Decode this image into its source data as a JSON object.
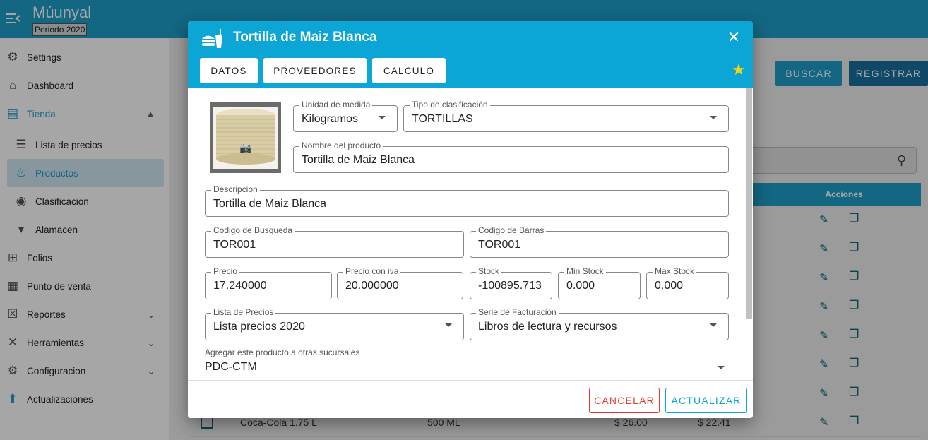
{
  "app": {
    "title": "Múunyal",
    "period": "Periodo 2020"
  },
  "sidebar": {
    "items": [
      {
        "label": "Settings",
        "icon": "gear-icon",
        "glyph": "⚙"
      },
      {
        "label": "Dashboard",
        "icon": "home-icon",
        "glyph": "⌂"
      },
      {
        "label": "Tienda",
        "icon": "store-icon",
        "glyph": "▤"
      },
      {
        "label": "Lista de precios",
        "icon": "clipboard-icon",
        "glyph": "☰"
      },
      {
        "label": "Productos",
        "icon": "food-icon",
        "glyph": "♨"
      },
      {
        "label": "Clasificacion",
        "icon": "broadcast-icon",
        "glyph": "◉"
      },
      {
        "label": "Alamacen",
        "icon": "caret-down-icon",
        "glyph": "▾"
      },
      {
        "label": "Folios",
        "icon": "folio-icon",
        "glyph": "⊞"
      },
      {
        "label": "Punto de venta",
        "icon": "cash-register-icon",
        "glyph": "▦"
      },
      {
        "label": "Reportes",
        "icon": "excel-icon",
        "glyph": "☒"
      },
      {
        "label": "Herramientas",
        "icon": "tools-icon",
        "glyph": "✕"
      },
      {
        "label": "Configuracion",
        "icon": "cog-icon",
        "glyph": "⚙"
      },
      {
        "label": "Actualizaciones",
        "icon": "upload-icon",
        "glyph": "⬆"
      }
    ]
  },
  "background": {
    "buscar_label": "BUSCAR",
    "registrar_label": "REGISTRAR",
    "acciones_header": "Acciones",
    "last_row": {
      "name": "Coca-Cola 1.75 L",
      "size": "500 ML",
      "price": "$ 26.00",
      "price2": "$ 22.41"
    }
  },
  "dialog": {
    "title": "Tortilla de Maiz Blanca",
    "tabs": [
      "DATOS",
      "PROVEEDORES",
      "CALCULO"
    ],
    "fields": {
      "unidad": {
        "label": "Unidad de medida",
        "value": "Kilogramos"
      },
      "tipo": {
        "label": "Tipo de clasificación",
        "value": "TORTILLAS"
      },
      "nombre": {
        "label": "Nombre del producto",
        "value": "Tortilla de Maiz Blanca"
      },
      "descripcion": {
        "label": "Descripcion",
        "value": "Tortilla de Maiz Blanca"
      },
      "codigo_busqueda": {
        "label": "Codigo de Busqueda",
        "value": "TOR001"
      },
      "codigo_barras": {
        "label": "Codigo de Barras",
        "value": "TOR001"
      },
      "precio": {
        "label": "Precio",
        "value": "17.240000"
      },
      "precio_iva": {
        "label": "Precio con iva",
        "value": "20.000000"
      },
      "stock": {
        "label": "Stock",
        "value": "-100895.713"
      },
      "min_stock": {
        "label": "Min Stock",
        "value": "0.000"
      },
      "max_stock": {
        "label": "Max Stock",
        "value": "0.000"
      },
      "lista_precios": {
        "label": "Lista de Precios",
        "value": "Lista precios 2020"
      },
      "serie": {
        "label": "Serie de Facturación",
        "value": "Libros de lectura y recursos"
      },
      "sucursales": {
        "label": "Agregar este producto a otras sucursales",
        "value": "PDC-CTM"
      }
    },
    "cancel_label": "CANCELAR",
    "update_label": "ACTUALIZAR"
  },
  "colors": {
    "primary": "#1e9ec8",
    "dialog_header": "#0ba5d6",
    "registrar": "#1a6fa0",
    "cancel": "#e53935",
    "update": "#0ba5d6",
    "star": "#f5d60e"
  }
}
